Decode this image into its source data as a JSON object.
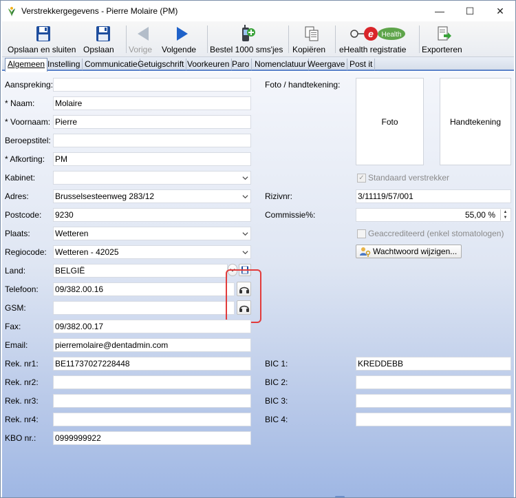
{
  "window": {
    "title": "Verstrekkergegevens - Pierre Molaire (PM)",
    "controls": {
      "minimize": "—",
      "maximize": "☐",
      "close": "✕"
    }
  },
  "toolbar": {
    "save_close": "Opslaan en sluiten",
    "save": "Opslaan",
    "previous": "Vorige",
    "next": "Volgende",
    "order_sms": "Bestel 1000 sms'jes",
    "copy": "Kopiëren",
    "ehealth": "eHealth registratie",
    "ehealth_logo_e": "e",
    "ehealth_logo_health": "Health",
    "export": "Exporteren"
  },
  "tabs": [
    "Algemeen",
    "Instelling",
    "Communicatie",
    "Getuigschrift",
    "Voorkeuren",
    "Paro",
    "Nomenclatuur",
    "Weergave",
    "Post it"
  ],
  "form": {
    "aanspreking": {
      "label": "Aanspreking:",
      "value": ""
    },
    "naam": {
      "label": "* Naam:",
      "value": "Molaire"
    },
    "voornaam": {
      "label": "* Voornaam:",
      "value": "Pierre"
    },
    "beroepstitel": {
      "label": "Beroepstitel:",
      "value": ""
    },
    "afkorting": {
      "label": "* Afkorting:",
      "value": "PM"
    },
    "kabinet": {
      "label": "Kabinet:",
      "value": ""
    },
    "adres": {
      "label": "Adres:",
      "value": "Brusselsesteenweg 283/12"
    },
    "postcode": {
      "label": "Postcode:",
      "value": "9230"
    },
    "plaats": {
      "label": "Plaats:",
      "value": "Wetteren"
    },
    "regiocode": {
      "label": "Regiocode:",
      "value": "Wetteren - 42025"
    },
    "land": {
      "label": "Land:",
      "value": "BELGIË"
    },
    "telefoon": {
      "label": "Telefoon:",
      "value": "09/382.00.16"
    },
    "gsm": {
      "label": "GSM:",
      "value": ""
    },
    "fax": {
      "label": "Fax:",
      "value": "09/382.00.17"
    },
    "email": {
      "label": "Email:",
      "value": "pierremolaire@dentadmin.com"
    },
    "rek1": {
      "label": "Rek. nr1:",
      "value": "BE11737027228448"
    },
    "rek2": {
      "label": "Rek. nr2:",
      "value": ""
    },
    "rek3": {
      "label": "Rek. nr3:",
      "value": ""
    },
    "rek4": {
      "label": "Rek. nr4:",
      "value": ""
    },
    "kbo": {
      "label": "KBO nr.:",
      "value": "0999999922"
    },
    "foto_label": "Foto / handtekening:",
    "foto_box": "Foto",
    "handtekening_box": "Handtekening",
    "standaard_verstrekker": "Standaard verstrekker",
    "rizivnr": {
      "label": "Rizivnr:",
      "value": "3/11119/57/001"
    },
    "commissie": {
      "label": "Commissie%:",
      "value": "55,00 %"
    },
    "geaccrediteerd": "Geaccrediteerd (enkel stomatologen)",
    "wachtwoord_button": "Wachtwoord wijzigen...",
    "bic1": {
      "label": "BIC 1:",
      "value": "KREDDEBB"
    },
    "bic2": {
      "label": "BIC 2:",
      "value": ""
    },
    "bic3": {
      "label": "BIC 3:",
      "value": ""
    },
    "bic4": {
      "label": "BIC 4:",
      "value": ""
    }
  },
  "colors": {
    "tab_accent": "#5a82c9",
    "highlight": "#e23b3b",
    "ehealth_red": "#d9252a",
    "ehealth_green": "#5ea44a"
  }
}
